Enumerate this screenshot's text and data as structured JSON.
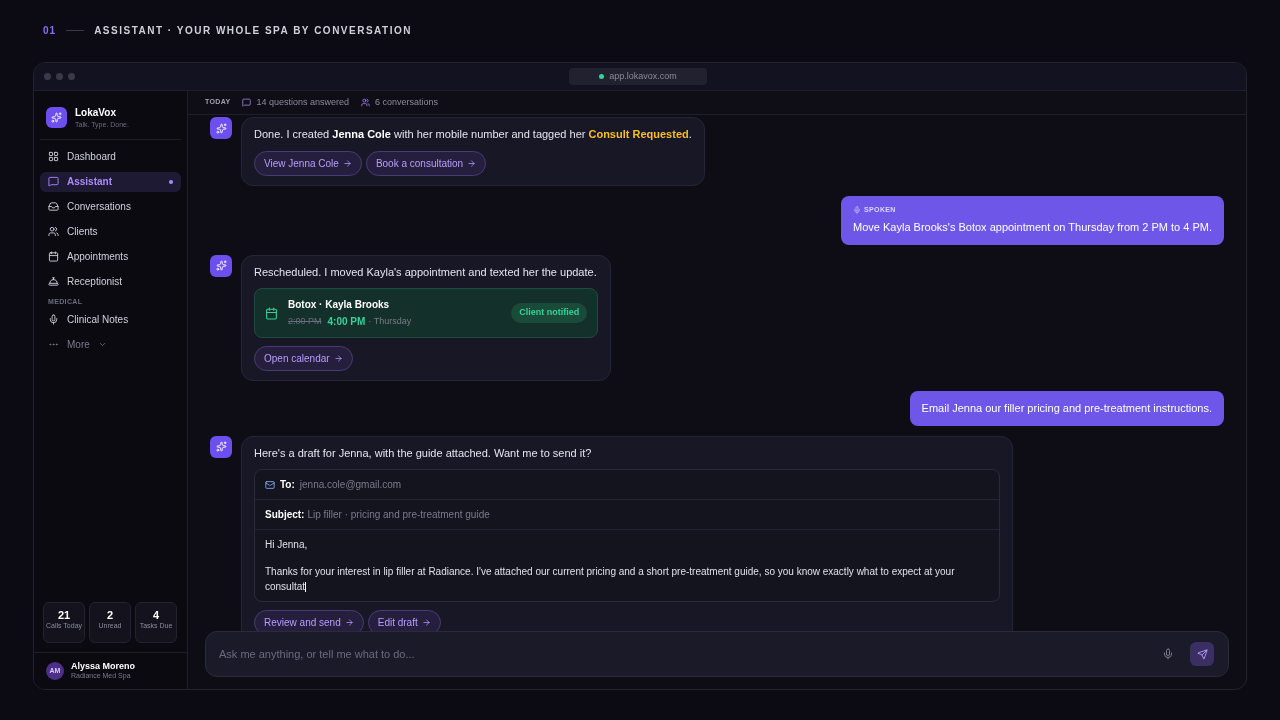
{
  "header": {
    "number": "01",
    "title": "ASSISTANT · YOUR WHOLE SPA BY CONVERSATION"
  },
  "window": {
    "url": "app.lokavox.com"
  },
  "brand": {
    "name": "LokaVox",
    "tagline": "Talk. Type. Done."
  },
  "sidebar": {
    "items": [
      {
        "kind": "nav",
        "label": "Dashboard",
        "selected": false,
        "dot": false
      },
      {
        "kind": "nav",
        "label": "Assistant",
        "selected": true,
        "dot": true
      },
      {
        "kind": "nav",
        "label": "Conversations",
        "selected": false,
        "dot": false
      },
      {
        "kind": "nav",
        "label": "Clients",
        "selected": false,
        "dot": false
      },
      {
        "kind": "nav",
        "label": "Appointments",
        "selected": false,
        "dot": false
      },
      {
        "kind": "nav",
        "label": "Receptionist",
        "selected": false,
        "dot": false
      },
      {
        "kind": "section",
        "label": "MEDICAL"
      },
      {
        "kind": "nav",
        "label": "Clinical Notes",
        "selected": false,
        "dot": false
      },
      {
        "kind": "more",
        "label": "More"
      }
    ],
    "stats": [
      {
        "value": "21",
        "label": "Calls Today"
      },
      {
        "value": "2",
        "label": "Unread"
      },
      {
        "value": "4",
        "label": "Tasks Due"
      }
    ],
    "user": {
      "initials": "AM",
      "name": "Alyssa Moreno",
      "org": "Radiance Med Spa"
    }
  },
  "topbar": {
    "label": "TODAY",
    "stats": [
      {
        "text": "14 questions answered"
      },
      {
        "text": "6 conversations"
      }
    ]
  },
  "messages": [
    {
      "kind": "assistant",
      "parts": [
        {
          "kind": "text",
          "text": "Done. I created "
        },
        {
          "kind": "strong",
          "text": "Jenna Cole"
        },
        {
          "kind": "text",
          "text": " with her mobile number and tagged her "
        },
        {
          "kind": "tag",
          "text": "Consult Requested"
        },
        {
          "kind": "text",
          "text": "."
        }
      ],
      "actions": [
        "View Jenna Cole",
        "Book a consultation"
      ]
    },
    {
      "kind": "user",
      "label": "SPOKEN",
      "text": "Move Kayla Brooks's Botox appointment on Thursday from 2 PM to 4 PM."
    },
    {
      "kind": "assistant",
      "parts": [
        {
          "kind": "text",
          "text": "Rescheduled. I moved Kayla's appointment and texted her the update."
        }
      ],
      "appointment": {
        "title": "Botox · Kayla Brooks",
        "old_time": "2:00 PM",
        "new_time": "4:00 PM",
        "day": "· Thursday",
        "status": "Client notified"
      },
      "actions": [
        "Open calendar"
      ]
    },
    {
      "kind": "user",
      "text": "Email Jenna our filler pricing and pre-treatment instructions."
    },
    {
      "kind": "assistant",
      "parts": [
        {
          "kind": "text",
          "text": "Here's a draft for Jenna, with the guide attached. Want me to send it?"
        }
      ],
      "email": {
        "to_label": "To:",
        "to": "jenna.cole@gmail.com",
        "subject_label": "Subject:",
        "subject": "Lip filler · pricing and pre-treatment guide",
        "body": [
          "Hi Jenna,",
          "Thanks for your interest in lip filler at Radiance. I've attached our current pricing and a short pre-treatment guide, so you know exactly what to expect at your consultat"
        ]
      },
      "actions": [
        "Review and send",
        "Edit draft"
      ]
    }
  ],
  "composer": {
    "placeholder": "Ask me anything, or tell me what to do..."
  }
}
